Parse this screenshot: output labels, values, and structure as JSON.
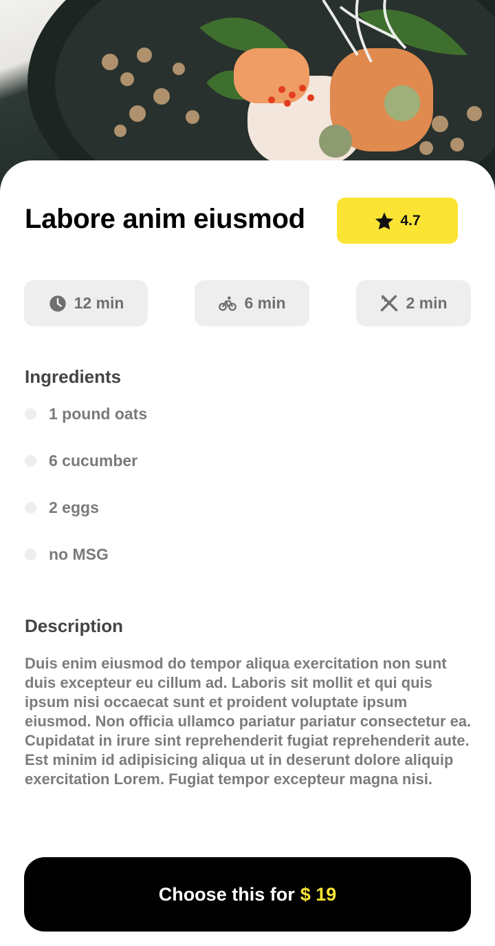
{
  "hero": {
    "image_alt": "sushi bowl photo"
  },
  "recipe": {
    "title": "Labore anim eiusmod",
    "rating": "4.7",
    "rating_icon": "star-icon"
  },
  "times": [
    {
      "label": "12 min",
      "icon": "clock-icon"
    },
    {
      "label": "6 min",
      "icon": "bike-icon"
    },
    {
      "label": "2 min",
      "icon": "utensils-icon"
    }
  ],
  "ingredients": {
    "title": "Ingredients",
    "items": [
      "1 pound oats",
      "6 cucumber",
      "2 eggs",
      "no MSG"
    ]
  },
  "description": {
    "title": "Description",
    "text": "Duis enim eiusmod do tempor aliqua exercitation non sunt duis excepteur eu cillum ad. Laboris sit mollit et qui quis ipsum nisi occaecat sunt et proident voluptate ipsum eiusmod. Non officia ullamco pariatur pariatur consectetur ea. Cupidatat in irure sint reprehenderit fugiat reprehenderit aute. Est minim id adipisicing aliqua ut in deserunt dolore aliquip exercitation Lorem. Fugiat tempor excepteur magna nisi."
  },
  "cta": {
    "label": "Choose this for",
    "price": "$ 19"
  },
  "colors": {
    "accent": "#fbe433",
    "chip_bg": "#eeeeee",
    "button_bg": "#000000"
  }
}
